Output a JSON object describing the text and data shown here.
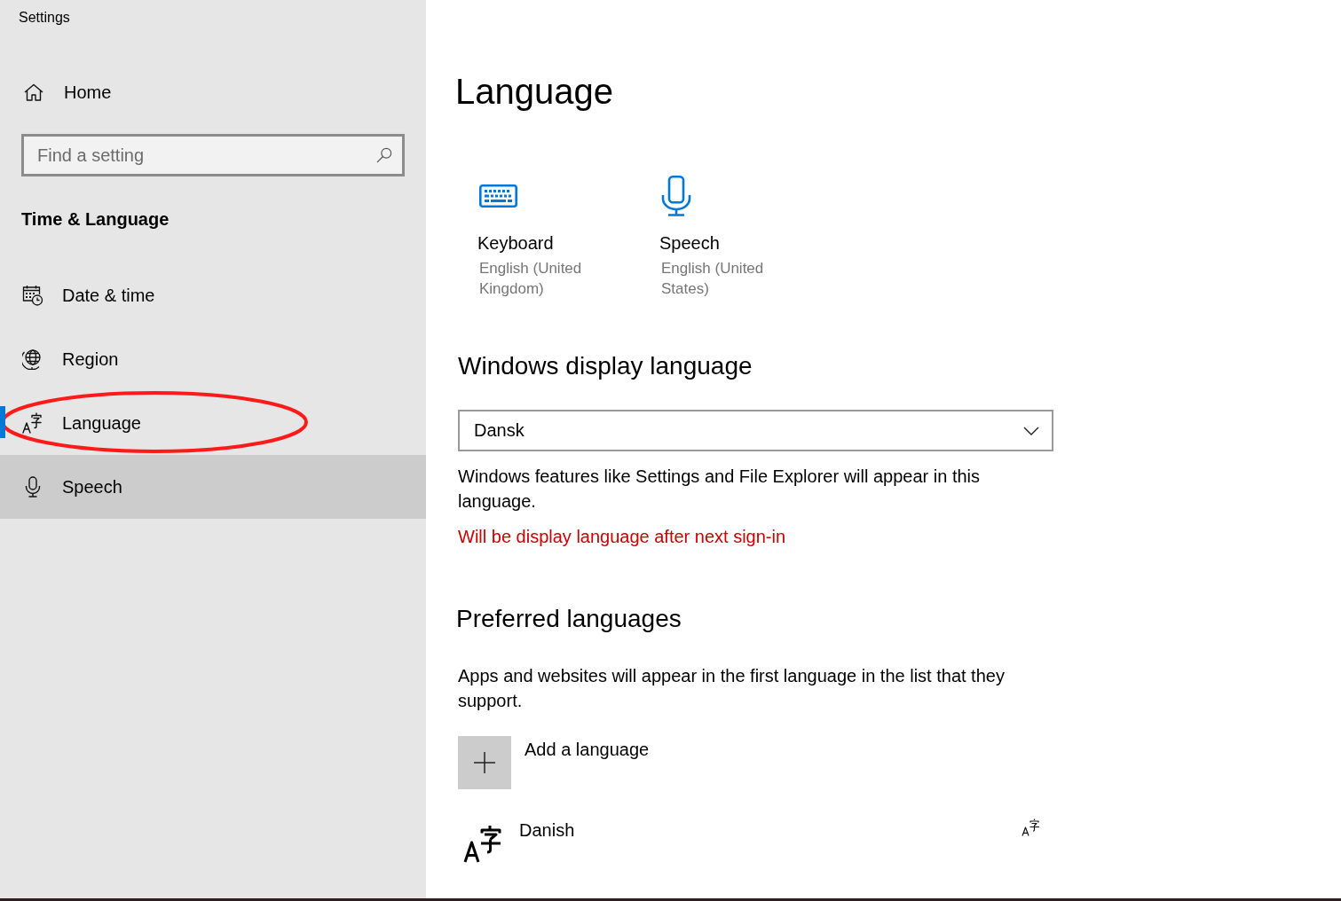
{
  "window": {
    "title": "Settings"
  },
  "sidebar": {
    "home": {
      "label": "Home"
    },
    "search": {
      "placeholder": "Find a setting"
    },
    "section_title": "Time & Language",
    "items": [
      {
        "label": "Date & time",
        "selected": false,
        "hovered": false,
        "circled": false
      },
      {
        "label": "Region",
        "selected": false,
        "hovered": false,
        "circled": false
      },
      {
        "label": "Language",
        "selected": true,
        "hovered": false,
        "circled": true
      },
      {
        "label": "Speech",
        "selected": false,
        "hovered": true,
        "circled": false
      }
    ]
  },
  "main": {
    "title": "Language",
    "quick_links": [
      {
        "title": "Keyboard",
        "subtitle": "English (United Kingdom)"
      },
      {
        "title": "Speech",
        "subtitle": "English (United States)"
      }
    ],
    "display_language": {
      "heading": "Windows display language",
      "dropdown": {
        "value": "Dansk"
      },
      "description": "Windows features like Settings and File Explorer will appear in this language.",
      "notice": "Will be display language after next sign-in"
    },
    "preferred_languages": {
      "heading": "Preferred languages",
      "description": "Apps and websites will appear in the first language in the list that they support.",
      "add_button": {
        "label": "Add a language"
      },
      "languages": [
        {
          "name": "Danish"
        }
      ]
    }
  }
}
